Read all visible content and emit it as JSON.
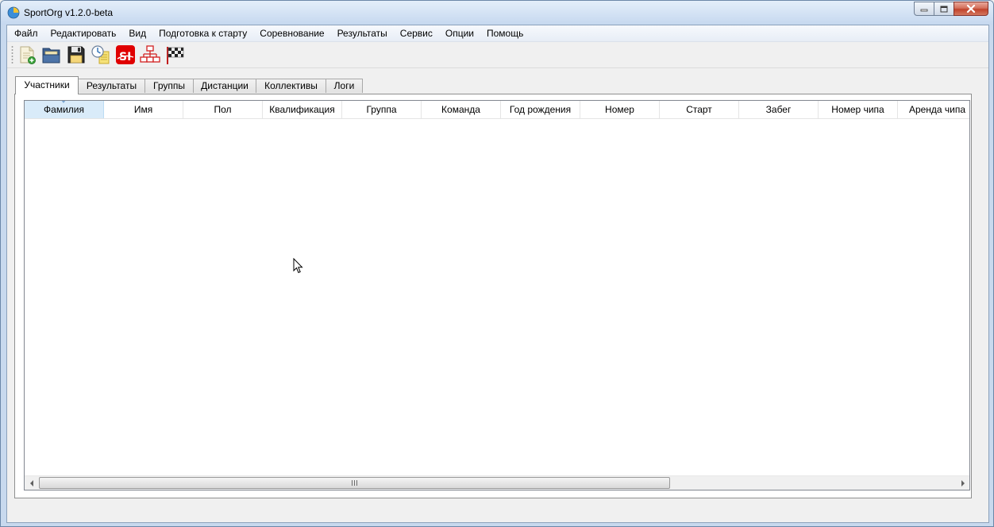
{
  "window": {
    "title": "SportOrg v1.2.0-beta",
    "controls": [
      "minimize-icon",
      "maximize-icon",
      "close-icon"
    ]
  },
  "menu": {
    "items": [
      {
        "label": "Файл"
      },
      {
        "label": "Редактировать"
      },
      {
        "label": "Вид"
      },
      {
        "label": "Подготовка к старту"
      },
      {
        "label": "Соревнование"
      },
      {
        "label": "Результаты"
      },
      {
        "label": "Сервис"
      },
      {
        "label": "Опции"
      },
      {
        "label": "Помощь"
      }
    ]
  },
  "toolbar": {
    "buttons": [
      {
        "icon": "new-file-icon"
      },
      {
        "icon": "open-folder-icon"
      },
      {
        "icon": "save-disk-icon"
      },
      {
        "icon": "time-clock-icon"
      },
      {
        "icon": "sportident-icon",
        "text": "SI"
      },
      {
        "icon": "network-icon"
      },
      {
        "icon": "finish-flag-icon"
      }
    ]
  },
  "tabs": [
    {
      "label": "Участники",
      "active": true
    },
    {
      "label": "Результаты"
    },
    {
      "label": "Группы"
    },
    {
      "label": "Дистанции"
    },
    {
      "label": "Коллективы"
    },
    {
      "label": "Логи"
    }
  ],
  "table": {
    "columns": [
      {
        "label": "Фамилия",
        "sorted": true
      },
      {
        "label": "Имя"
      },
      {
        "label": "Пол"
      },
      {
        "label": "Квалификация"
      },
      {
        "label": "Группа"
      },
      {
        "label": "Команда"
      },
      {
        "label": "Год рождения"
      },
      {
        "label": "Номер"
      },
      {
        "label": "Старт"
      },
      {
        "label": "Забег"
      },
      {
        "label": "Номер чипа"
      },
      {
        "label": "Аренда чипа"
      }
    ],
    "rows": []
  },
  "colors": {
    "title_bar": "#c6d8ef",
    "close_button": "#c1432c",
    "sorted_header": "#d9ebf9",
    "si_red": "#e00000"
  }
}
